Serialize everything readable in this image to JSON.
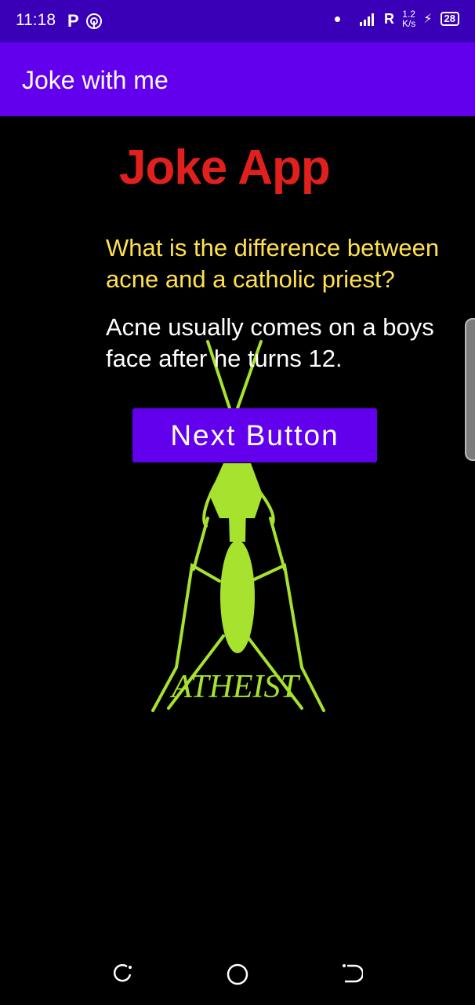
{
  "status_bar": {
    "time": "11:18",
    "signal_letter": "R",
    "speed_top": "1.2",
    "speed_bottom": "K/s",
    "battery": "28"
  },
  "app_bar": {
    "title": "Joke with me"
  },
  "main": {
    "heading": "Joke App",
    "question": "What is the difference between acne and a catholic priest?",
    "answer": "Acne usually comes on a boys face after he turns 12.",
    "next_button_label": "Next Button",
    "image_label": "ATHEIST"
  },
  "colors": {
    "status_bar": "#3a00b8",
    "app_bar": "#6200ee",
    "heading": "#e0201c",
    "question": "#ffe14d",
    "mantis": "#a6e22e"
  },
  "nav_bar": {
    "icons": [
      "recent-apps-icon",
      "home-icon",
      "back-icon"
    ]
  }
}
